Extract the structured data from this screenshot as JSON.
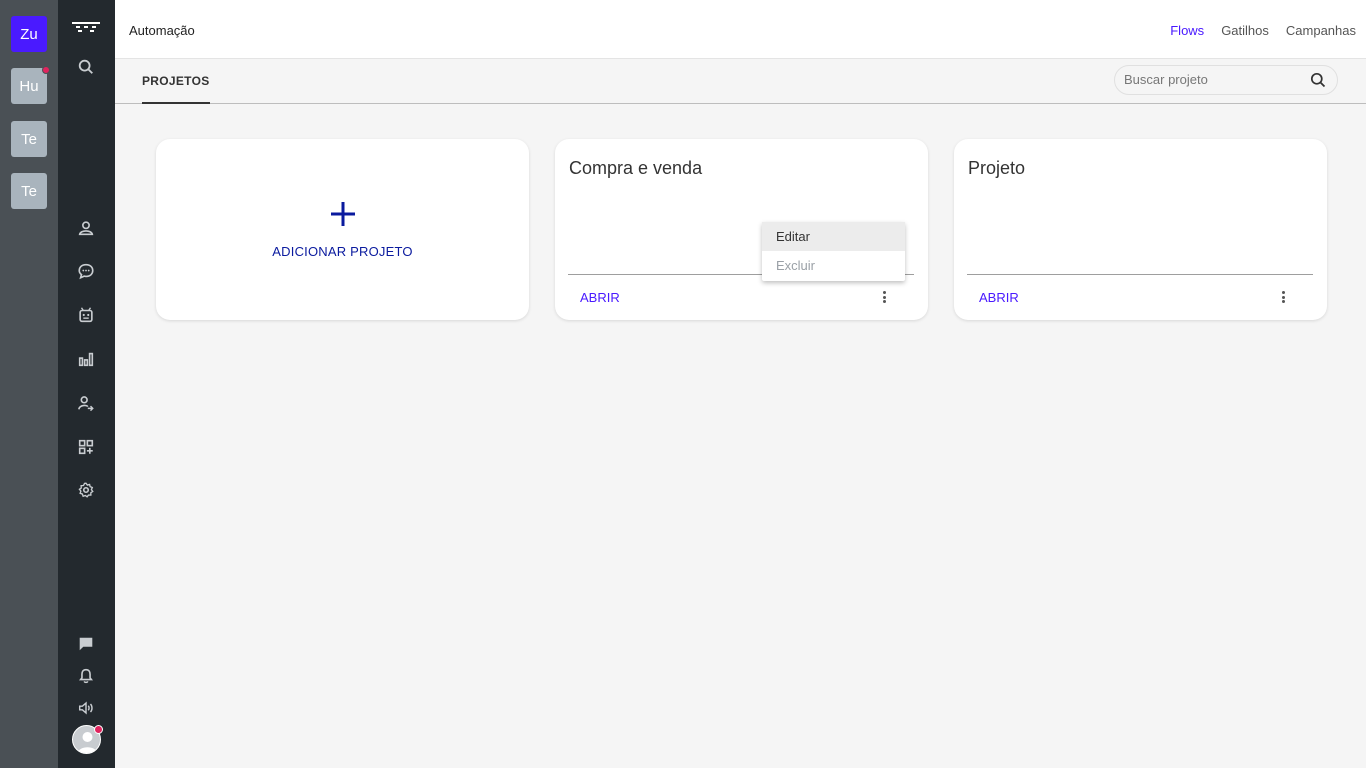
{
  "workspaces": [
    {
      "label": "Zu",
      "active": true,
      "notification": false
    },
    {
      "label": "Hu",
      "active": false,
      "notification": true
    },
    {
      "label": "Te",
      "active": false,
      "notification": false
    },
    {
      "label": "Te",
      "active": false,
      "notification": false
    }
  ],
  "nav_icons": [
    "logo-icon",
    "search-icon",
    "contacts-icon",
    "chat-bubble-icon",
    "bot-icon",
    "bar-chart-icon",
    "user-arrow-icon",
    "apps-icon",
    "gear-icon",
    "message-icon",
    "bell-icon",
    "speaker-icon"
  ],
  "header": {
    "title": "Automação",
    "links": [
      "Flows",
      "Gatilhos",
      "Campanhas"
    ],
    "active_link": "Flows"
  },
  "tabs": {
    "projects": "PROJETOS"
  },
  "search": {
    "placeholder": "Buscar projeto"
  },
  "add_card": {
    "label": "ADICIONAR PROJETO"
  },
  "projects": [
    {
      "title": "Compra e venda",
      "open_label": "ABRIR"
    },
    {
      "title": "Projeto",
      "open_label": "ABRIR"
    }
  ],
  "context_menu": {
    "edit": "Editar",
    "delete": "Excluir"
  },
  "colors": {
    "accent": "#4a1aff",
    "add_blue": "#0a1a9e",
    "nav_bg": "#23292e",
    "rail_bg": "#4a5055"
  }
}
